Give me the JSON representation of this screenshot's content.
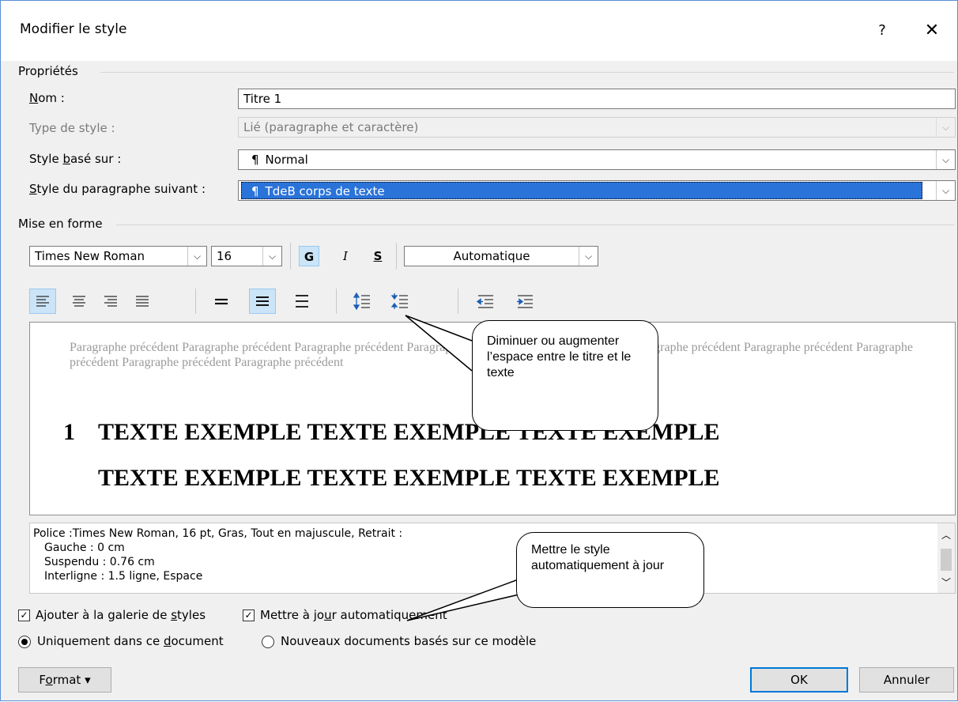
{
  "window": {
    "title": "Modifier le style",
    "help_glyph": "?",
    "close_glyph": "✕"
  },
  "properties": {
    "section_label": "Propriétés",
    "name": {
      "label_pre": "",
      "label_u": "N",
      "label_post": "om :",
      "value": "Titre 1"
    },
    "style_type": {
      "label": "Type de style :",
      "value": "Lié (paragraphe et caractère)"
    },
    "based_on": {
      "label_pre": "Style ",
      "label_u": "b",
      "label_post": "asé sur :",
      "pilcrow": "¶",
      "value": "Normal"
    },
    "next_style": {
      "label_pre": "",
      "label_u": "S",
      "label_post": "tyle du paragraphe suivant :",
      "pilcrow": "¶",
      "value": "TdeB corps de texte"
    }
  },
  "formatting": {
    "section_label": "Mise en forme",
    "font": "Times New Roman",
    "size": "16",
    "bold": "G",
    "italic": "I",
    "underline": "S",
    "color": "Automatique"
  },
  "preview": {
    "previous_paragraph": "Paragraphe précédent Paragraphe précédent Paragraphe précédent Paragraphe précédent Paragraphe précédent Paragraphe précédent Paragraphe précédent Paragraphe précédent Paragraphe précédent Paragraphe précédent",
    "sample_number": "1",
    "sample_line1": "TEXTE EXEMPLE TEXTE EXEMPLE TEXTE EXEMPLE",
    "sample_line2": "TEXTE EXEMPLE TEXTE EXEMPLE TEXTE EXEMPLE"
  },
  "description": {
    "line1": "Police :Times New Roman, 16 pt, Gras, Tout en majuscule, Retrait :",
    "line2": "Gauche :  0 cm",
    "line3": "Suspendu : 0.76 cm",
    "line4": "Interligne : 1.5 ligne, Espace"
  },
  "options": {
    "add_gallery": {
      "pre": "Ajouter à la galerie de ",
      "u": "s",
      "post": "tyles",
      "checked": true
    },
    "auto_update": {
      "pre": "Mettre à jo",
      "u": "u",
      "post": "r automatiquement",
      "checked": true
    },
    "only_doc": {
      "pre": "Uniquement dans ce ",
      "u": "d",
      "post": "ocument",
      "selected": true
    },
    "new_docs": {
      "label": "Nouveaux documents basés sur ce modèle",
      "selected": false
    }
  },
  "buttons": {
    "format_pre": "F",
    "format_u": "o",
    "format_post": "rmat",
    "format_arrow": "▾",
    "ok": "OK",
    "cancel": "Annuler"
  },
  "callouts": {
    "spacing": "Diminuer ou augmenter l’espace entre le titre et le texte",
    "auto_update": "Mettre le style automatiquement à jour"
  }
}
